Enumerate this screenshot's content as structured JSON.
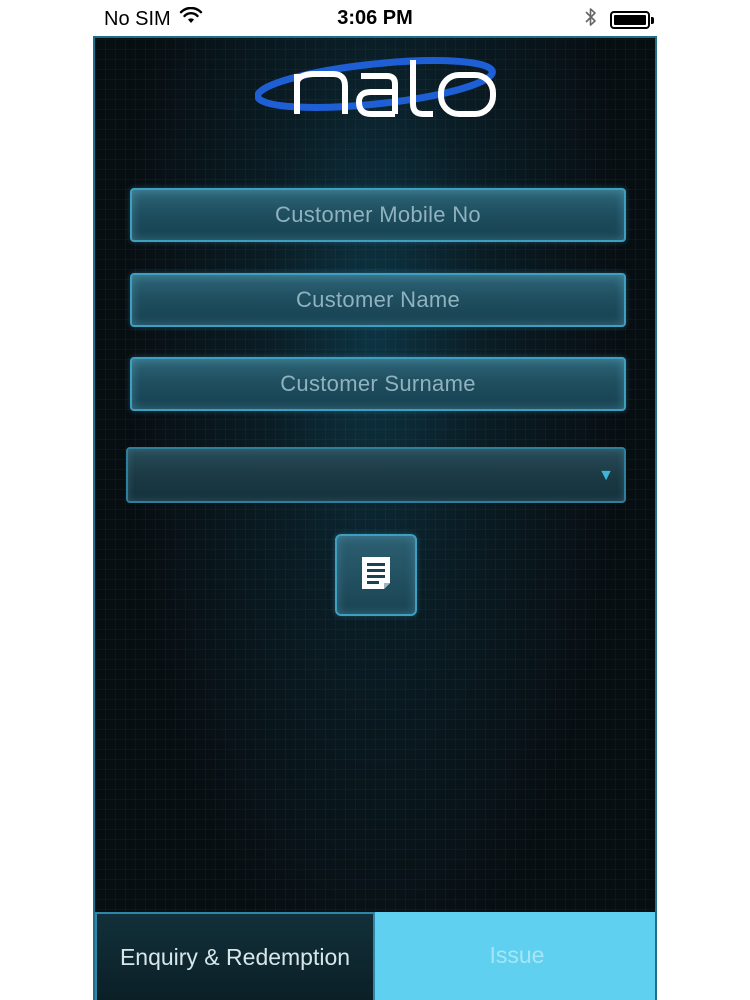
{
  "status_bar": {
    "carrier": "No SIM",
    "time": "3:06 PM"
  },
  "app": {
    "logo_text": "nalo"
  },
  "form": {
    "mobile_placeholder": "Customer Mobile No",
    "name_placeholder": "Customer Name",
    "surname_placeholder": "Customer Surname",
    "dropdown_value": ""
  },
  "tabs": {
    "enquiry_label": "Enquiry & Redemption",
    "issue_label": "Issue"
  },
  "colors": {
    "accent": "#5fd0ef",
    "field_border": "#3f9fc0",
    "background": "#070e12"
  },
  "icons": {
    "wifi": "wifi-icon",
    "bluetooth": "bluetooth-icon",
    "battery": "battery-icon",
    "dropdown": "triangle-down-icon",
    "document": "document-icon"
  }
}
